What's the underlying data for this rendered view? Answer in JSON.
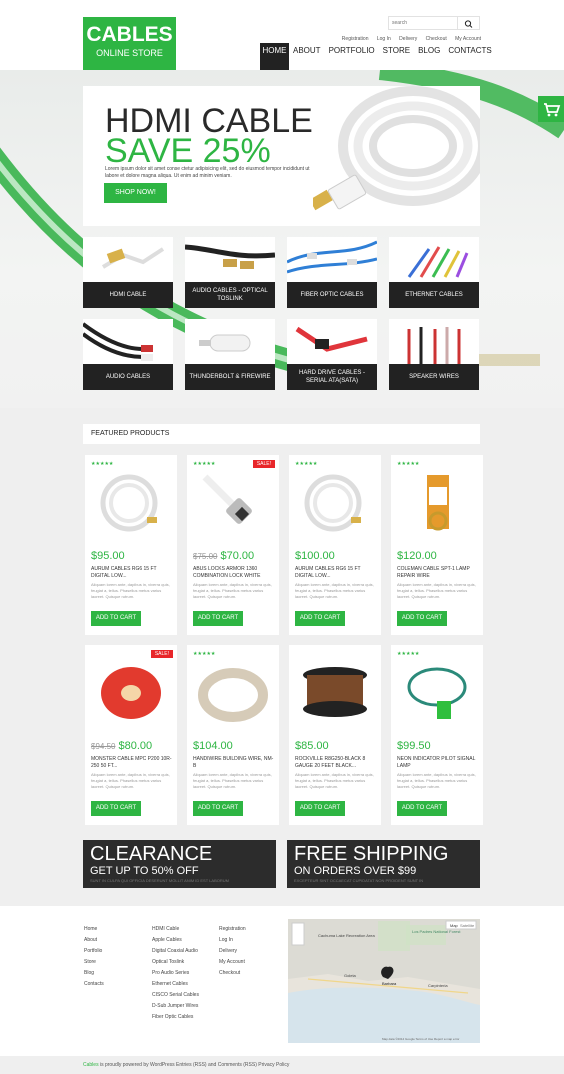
{
  "brand": {
    "line1": "CABLES",
    "line2": "ONLINE STORE"
  },
  "search": {
    "placeholder": "search"
  },
  "toplinks": [
    "Registration",
    "Log In",
    "Delivery",
    "Checkout",
    "My Account"
  ],
  "nav": [
    "HOME",
    "ABOUT",
    "PORTFOLIO",
    "STORE",
    "BLOG",
    "CONTACTS"
  ],
  "banner": {
    "title": "HDMI CABLE",
    "subtitle": "SAVE 25%",
    "desc": "Lorem ipsum dolor sit amet conse ctetur adipisicing elit, sed do eiusmod tempor incididunt ut labore et dolore magna aliqua. Ut enim ad minim veniam.",
    "cta": "SHOP NOW!"
  },
  "categories": [
    "HDMI CABLE",
    "AUDIO CABLES - OPTICAL TOSLINK",
    "FIBER OPTIC CABLES",
    "ETHERNET CABLES",
    "AUDIO CABLES",
    "THUNDERBOLT & FIREWIRE",
    "HARD DRIVE CABLES - SERIAL ATA(SATA)",
    "SPEAKER WIRES"
  ],
  "featured": {
    "title": "FEATURED PRODUCTS",
    "add_label": "ADD TO CART",
    "sale_label": "SALE!",
    "desc": "Aliquam lorem ante, dapibus in, viverra quis, feugiat a, tellus. Phasellus metus varius laoreet. Quisque rutrum.",
    "products": [
      {
        "old": "",
        "price": "$95.00",
        "name": "AURUM CABLES RG6 15 FT DIGITAL LOW...",
        "sale": false
      },
      {
        "old": "$75.00",
        "price": "$70.00",
        "name": "ABUS LOCKS ARMOR 1360 COMBINATION LOCK WHITE",
        "sale": true
      },
      {
        "old": "",
        "price": "$100.00",
        "name": "AURUM CABLES RG6 15 FT DIGITAL LOW...",
        "sale": false
      },
      {
        "old": "",
        "price": "$120.00",
        "name": "COLEMAN CABLE SPT-1 LAMP REPAIR WIRE",
        "sale": false
      },
      {
        "old": "$94.50",
        "price": "$80.00",
        "name": "MONSTER CABLE MPC P200 10R-250 50 FT...",
        "sale": true
      },
      {
        "old": "",
        "price": "$104.00",
        "name": "HANDIWIRE BUILDING WIRE, NM-B",
        "sale": false
      },
      {
        "old": "",
        "price": "$85.00",
        "name": "ROCKVILLE R8G250-BLACK 8 GAUGE 20 FEET BLACK...",
        "sale": false
      },
      {
        "old": "",
        "price": "$99.50",
        "name": "NEON INDICATOR PILOT SIGNAL LAMP",
        "sale": false
      }
    ]
  },
  "promos": [
    {
      "title": "CLEARANCE",
      "sub": "GET UP TO 50% OFF",
      "fine": "SUNT IN CULPA QUI OFFICIA DESERUNT MOLLIT ANIM ID EST LABORUM"
    },
    {
      "title": "FREE SHIPPING",
      "sub": "ON ORDERS OVER $99",
      "fine": "EXCEPTEUR SINT OCCAECAT CUPIDATAT NON PROIDENT SUNT IN"
    }
  ],
  "footer": {
    "col1": [
      "Home",
      "About",
      "Portfolio",
      "Store",
      "Blog",
      "Contacts"
    ],
    "col2": [
      "HDMI Cable",
      "Apple Cables",
      "Digital Coaxial Audio",
      "Optical Toslink",
      "Pro Audio Series",
      "Ethernet Cables",
      "CISCO Serial Cables",
      "D-Sub Jumper Wires",
      "Fiber Optic Cables"
    ],
    "col3": [
      "Registration",
      "Log In",
      "Delivery",
      "My Account",
      "Checkout"
    ],
    "map": {
      "map_btn": "Map",
      "sat_btn": "Satellite",
      "label_lake": "Cachuma Lake Recreation Area",
      "label_forest": "Los Padres National Forest",
      "label_city": "Barbara",
      "label_goleta": "Goleta",
      "label_carp": "Carpinteria",
      "credit": "Map data ©2014 Google   Terms of Use   Report a map error"
    },
    "copyright_brand": "Cables",
    "copyright_rest": " is proudly powered by WordPress Entries (RSS) and Comments (RSS) Privacy Policy"
  },
  "colors": {
    "accent": "#2eb543",
    "dark": "#222222",
    "sale": "#e8262a"
  }
}
